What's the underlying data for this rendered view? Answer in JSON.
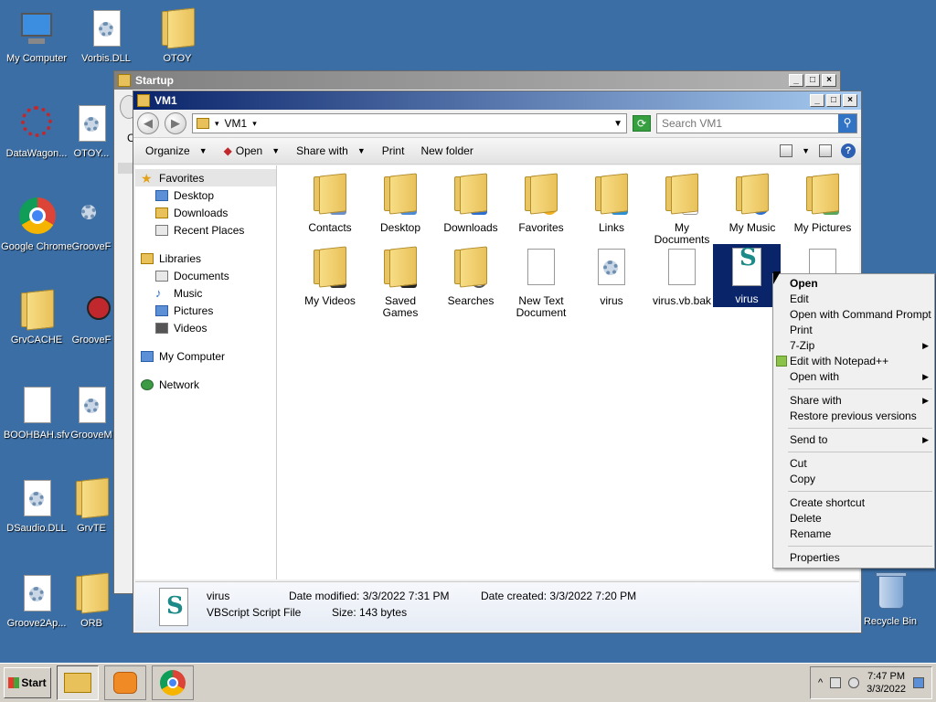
{
  "desktop": {
    "icons": [
      {
        "label": "My Computer"
      },
      {
        "label": "Vorbis.DLL"
      },
      {
        "label": "OTOY"
      },
      {
        "label": "DataWagon..."
      },
      {
        "label": "OTOY..."
      },
      {
        "label": "Google Chrome"
      },
      {
        "label": "GrooveF"
      },
      {
        "label": "GrvCACHE"
      },
      {
        "label": "GrooveF"
      },
      {
        "label": "BOOHBAH.sfv"
      },
      {
        "label": "GrooveM"
      },
      {
        "label": "DSaudio.DLL"
      },
      {
        "label": "GrvTE"
      },
      {
        "label": "Groove2Ap..."
      },
      {
        "label": "ORB"
      },
      {
        "label": "Recycle Bin"
      }
    ]
  },
  "startup_window": {
    "title": "Startup",
    "partial_label": "C"
  },
  "window": {
    "title": "VM1",
    "address": "VM1",
    "search_placeholder": "Search VM1",
    "toolbar": {
      "organize": "Organize",
      "open": "Open",
      "share_with": "Share with",
      "print": "Print",
      "new_folder": "New folder"
    },
    "nav": {
      "favorites": "Favorites",
      "desktop": "Desktop",
      "downloads": "Downloads",
      "recent_places": "Recent Places",
      "libraries": "Libraries",
      "documents": "Documents",
      "music": "Music",
      "pictures": "Pictures",
      "videos": "Videos",
      "my_computer": "My Computer",
      "network": "Network"
    },
    "files": [
      {
        "label": "Contacts"
      },
      {
        "label": "Desktop"
      },
      {
        "label": "Downloads"
      },
      {
        "label": "Favorites"
      },
      {
        "label": "Links"
      },
      {
        "label": "My Documents"
      },
      {
        "label": "My Music"
      },
      {
        "label": "My Pictures"
      },
      {
        "label": "My Videos"
      },
      {
        "label": "Saved Games"
      },
      {
        "label": "Searches"
      },
      {
        "label": "New Text Document"
      },
      {
        "label": "virus"
      },
      {
        "label": "virus.vb.bak"
      },
      {
        "label": "virus"
      }
    ],
    "details": {
      "name": "virus",
      "type": "VBScript Script File",
      "date_modified_label": "Date modified:",
      "date_modified": "3/3/2022 7:31 PM",
      "size_label": "Size:",
      "size": "143 bytes",
      "date_created_label": "Date created:",
      "date_created": "3/3/2022 7:20 PM"
    }
  },
  "context_menu": {
    "open": "Open",
    "edit": "Edit",
    "open_cmd": "Open with Command Prompt",
    "print": "Print",
    "seven_zip": "7-Zip",
    "edit_npp": "Edit with Notepad++",
    "open_with": "Open with",
    "share_with": "Share with",
    "restore": "Restore previous versions",
    "send_to": "Send to",
    "cut": "Cut",
    "copy": "Copy",
    "create_shortcut": "Create shortcut",
    "delete": "Delete",
    "rename": "Rename",
    "properties": "Properties"
  },
  "taskbar": {
    "start": "Start",
    "time": "7:47 PM",
    "date": "3/3/2022"
  }
}
